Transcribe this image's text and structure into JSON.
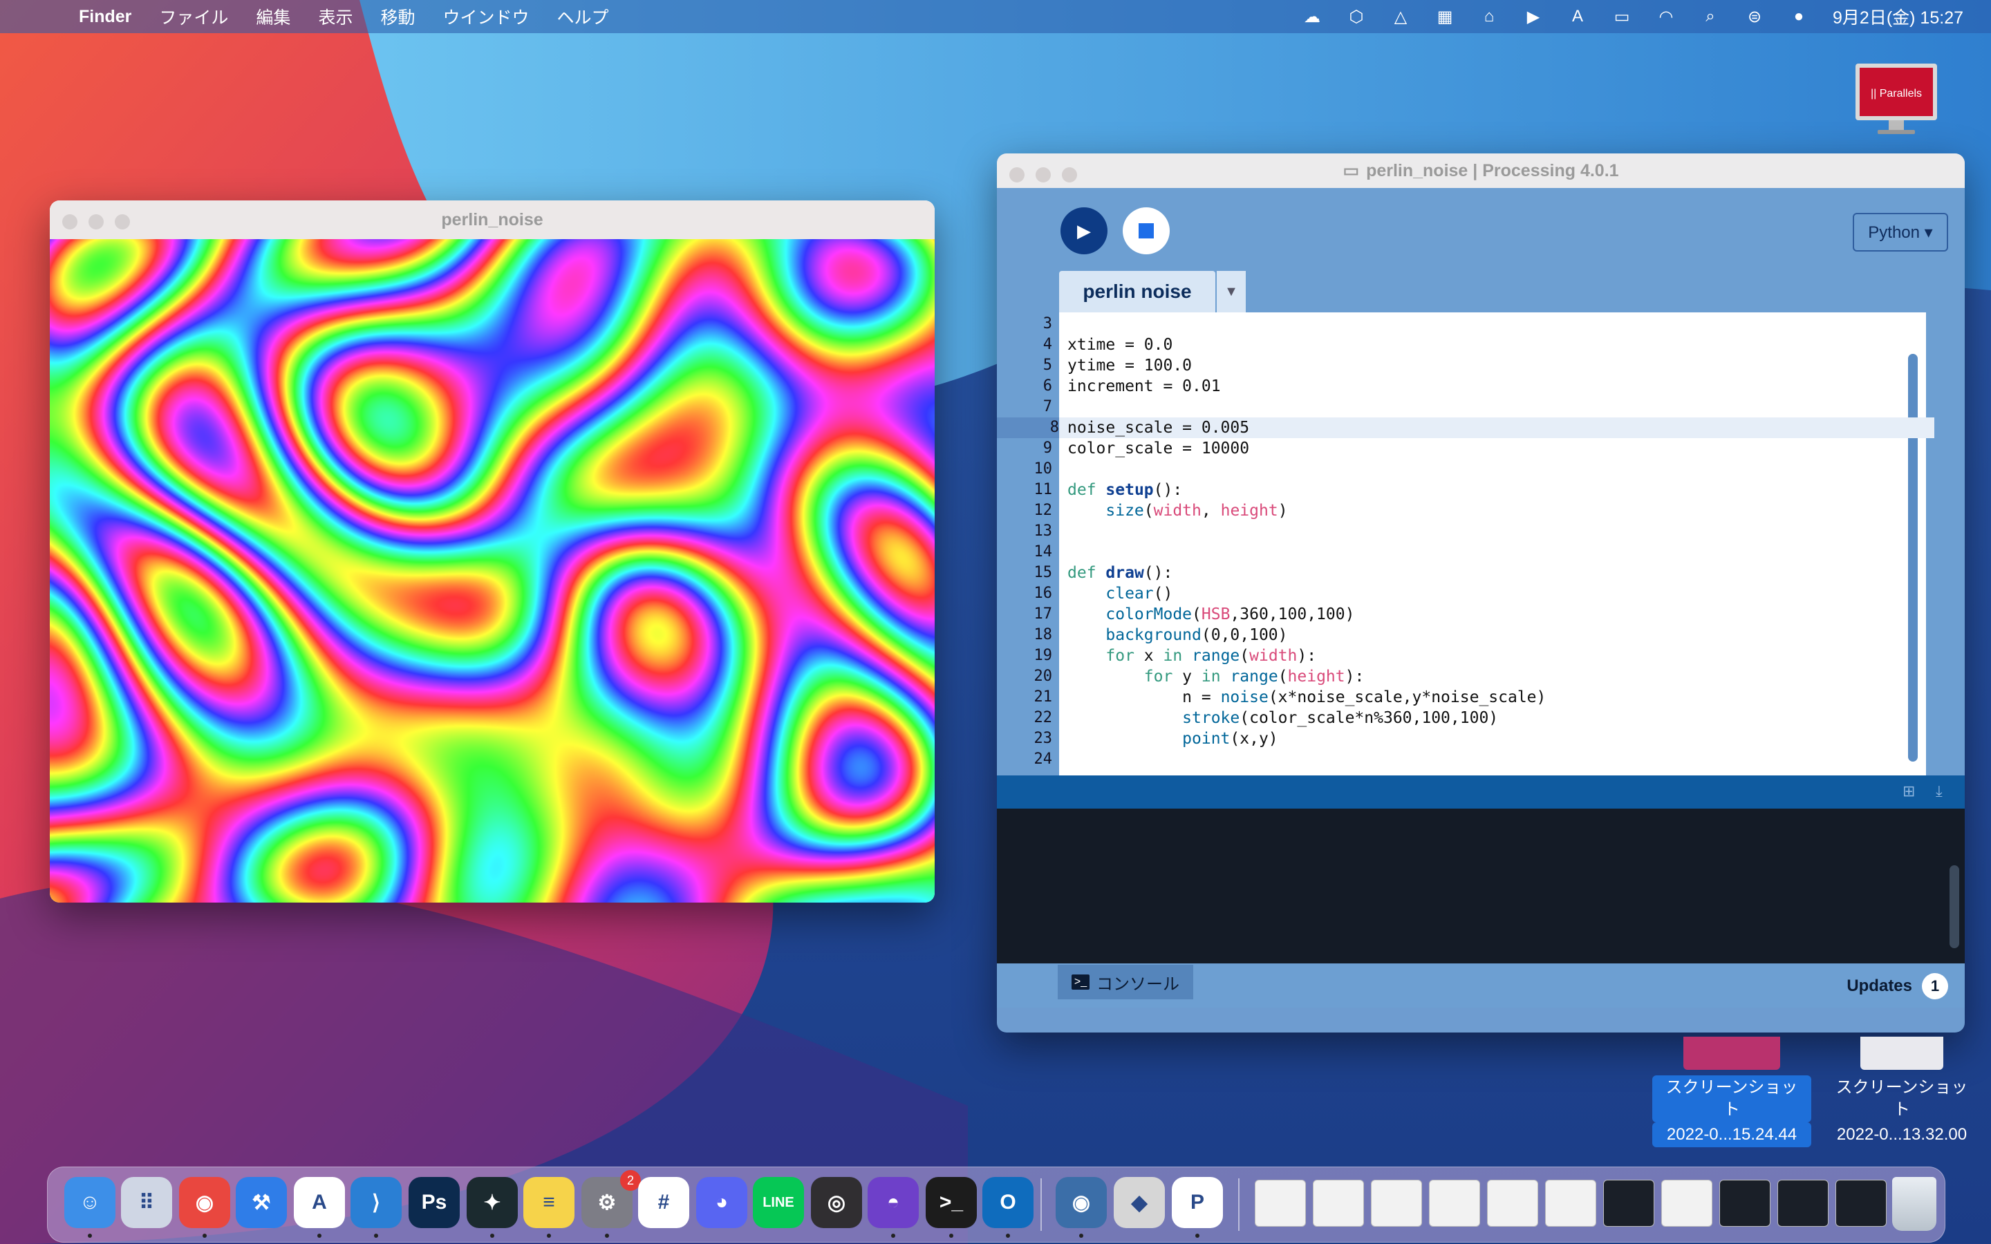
{
  "menubar": {
    "app_name": "Finder",
    "menus": [
      "ファイル",
      "編集",
      "表示",
      "移動",
      "ウインドウ",
      "ヘルプ"
    ],
    "clock": "9月2日(金)  15:27"
  },
  "sketch_window": {
    "title": "perlin_noise"
  },
  "ide_window": {
    "title": "perlin_noise | Processing 4.0.1",
    "mode_button": "Python ▾",
    "tab_label": "perlin noise",
    "current_line": 8,
    "code_lines": [
      {
        "n": "3",
        "text": ""
      },
      {
        "n": "4",
        "text": "xtime = 0.0"
      },
      {
        "n": "5",
        "text": "ytime = 100.0"
      },
      {
        "n": "6",
        "text": "increment = 0.01"
      },
      {
        "n": "7",
        "text": ""
      },
      {
        "n": "8",
        "text": "noise_scale = 0.005"
      },
      {
        "n": "9",
        "text": "color_scale = 10000"
      },
      {
        "n": "10",
        "text": ""
      },
      {
        "n": "11",
        "text": "def setup():"
      },
      {
        "n": "12",
        "text": "    size(width, height)"
      },
      {
        "n": "13",
        "text": ""
      },
      {
        "n": "14",
        "text": ""
      },
      {
        "n": "15",
        "text": "def draw():"
      },
      {
        "n": "16",
        "text": "    clear()"
      },
      {
        "n": "17",
        "text": "    colorMode(HSB,360,100,100)"
      },
      {
        "n": "18",
        "text": "    background(0,0,100)"
      },
      {
        "n": "19",
        "text": "    for x in range(width):"
      },
      {
        "n": "20",
        "text": "        for y in range(height):"
      },
      {
        "n": "21",
        "text": "            n = noise(x*noise_scale,y*noise_scale)"
      },
      {
        "n": "22",
        "text": "            stroke(color_scale*n%360,100,100)"
      },
      {
        "n": "23",
        "text": "            point(x,y)"
      },
      {
        "n": "24",
        "text": ""
      }
    ],
    "console_tab": "コンソール",
    "updates_label": "Updates",
    "updates_count": "1"
  },
  "desktop_icons": [
    {
      "line1": "スクリーンショット",
      "line2": "2022-0...15.24.44",
      "selected": true
    },
    {
      "line1": "スクリーンショット",
      "line2": "2022-0...13.32.00",
      "selected": false
    }
  ],
  "parallels_label": "|| Parallels",
  "dock": {
    "apps": [
      {
        "name": "finder",
        "color": "#3d8fe8",
        "label": "☺"
      },
      {
        "name": "launchpad",
        "color": "#cfd6e4",
        "label": "⠿"
      },
      {
        "name": "chrome",
        "color": "#e9473f",
        "label": "◉"
      },
      {
        "name": "xcode",
        "color": "#2f7de8",
        "label": "⚒"
      },
      {
        "name": "app-store",
        "color": "#ffffff",
        "label": "A"
      },
      {
        "name": "vscode",
        "color": "#2a7fd4",
        "label": "⟩"
      },
      {
        "name": "photoshop",
        "color": "#0c2a4e",
        "label": "Ps"
      },
      {
        "name": "filmora",
        "color": "#1b2a2f",
        "label": "✦"
      },
      {
        "name": "notes",
        "color": "#f6d34a",
        "label": "≡"
      },
      {
        "name": "system-preferences",
        "color": "#7d7d86",
        "label": "⚙"
      },
      {
        "name": "slack",
        "color": "#ffffff",
        "label": "#"
      },
      {
        "name": "discord",
        "color": "#5865f2",
        "label": "◕"
      },
      {
        "name": "line",
        "color": "#06c755",
        "label": "LINE"
      },
      {
        "name": "obs",
        "color": "#302e31",
        "label": "◎"
      },
      {
        "name": "github-desktop",
        "color": "#6e40c9",
        "label": "◓"
      },
      {
        "name": "terminal",
        "color": "#1c1c1c",
        "label": ">_"
      },
      {
        "name": "outlook",
        "color": "#0f6cbd",
        "label": "O"
      },
      {
        "name": "finder-eye",
        "color": "#3b6ea8",
        "label": "◉"
      },
      {
        "name": "unity",
        "color": "#d6d6d6",
        "label": "◆"
      },
      {
        "name": "processing",
        "color": "#ffffff",
        "label": "P"
      }
    ],
    "system_preferences_badge": "2"
  },
  "colors": {
    "accent": "#1e6fd9",
    "ide_bg": "#6d9fd2",
    "run_button": "#0d3b85"
  }
}
